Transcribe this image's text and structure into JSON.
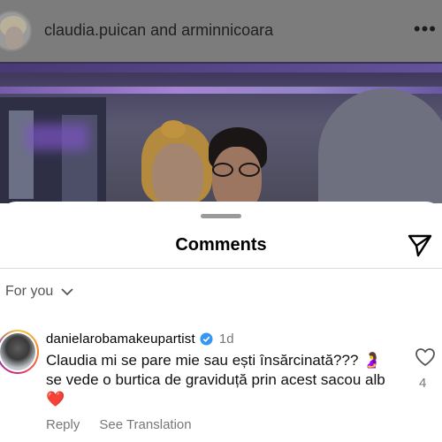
{
  "post": {
    "title_user1": "claudia.puican",
    "title_joiner": " and ",
    "title_user2": "arminnicoara",
    "more_label": "•••"
  },
  "comments_sheet": {
    "title": "Comments",
    "filter_label": "For you"
  },
  "comment": {
    "username": "danielarobamakeupartist",
    "verified": true,
    "time": "1d",
    "text": "Claudia mi se pare mie sau ești însărcinată??? 🤰 se vede o burtica de graviduță prin acest sacou alb ❤️",
    "reply_label": "Reply",
    "translation_label": "See Translation",
    "like_count": "4"
  },
  "colors": {
    "verified_blue": "#3797f0",
    "overlay_dim": "#7c7c7c"
  },
  "icons": [
    "more-icon",
    "send-icon",
    "chevron-down-icon",
    "verified-icon",
    "heart-outline-icon"
  ]
}
